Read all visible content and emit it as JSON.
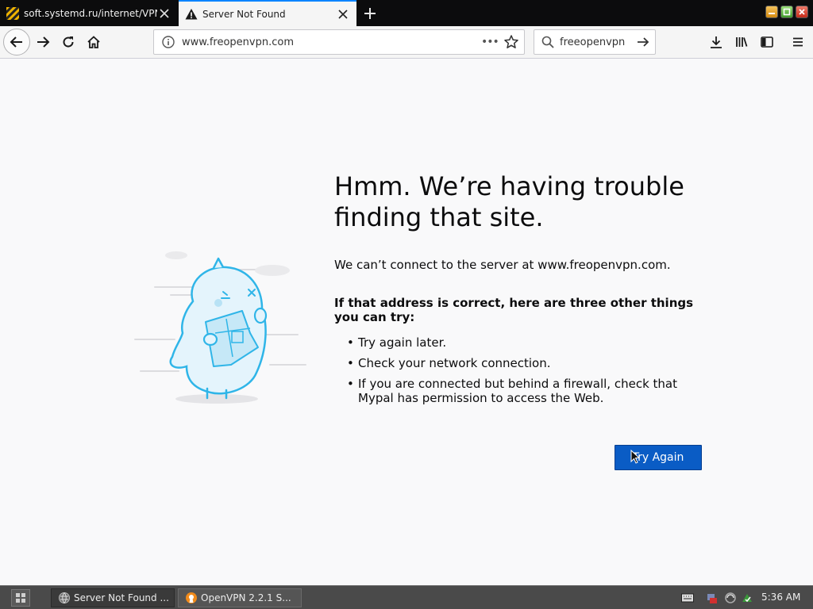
{
  "browser": {
    "tabs": [
      {
        "title": "soft.systemd.ru/internet/VPN",
        "favicon": "striped-hazard-icon",
        "active": false
      },
      {
        "title": "Server Not Found",
        "favicon": "warning-icon",
        "active": true
      }
    ],
    "url": "www.freopenvpn.com",
    "search_value": "freeopenvpn",
    "colors": {
      "tab_strip": "#0c0c0d",
      "active_tab_accent": "#0a84ff",
      "toolbar": "#f5f5f5"
    }
  },
  "error_page": {
    "title": "Hmm. We’re having trouble finding that site.",
    "description": "We can’t connect to the server at www.freopenvpn.com.",
    "subheading": "If that address is correct, here are three other things you can try:",
    "tips": [
      "Try again later.",
      "Check your network connection.",
      "If you are connected but behind a firewall, check that Mypal has permission to access the Web."
    ],
    "try_again_label": "Try Again",
    "colors": {
      "button": "#0a5cc5",
      "background": "#f9f9fa",
      "illustration": "#2fb5e8"
    }
  },
  "taskbar": {
    "tasks": [
      {
        "label": "Server Not Found ...",
        "icon": "browser-icon"
      },
      {
        "label": "OpenVPN 2.2.1  S...",
        "icon": "openvpn-icon"
      }
    ],
    "clock": "5:36 AM"
  }
}
